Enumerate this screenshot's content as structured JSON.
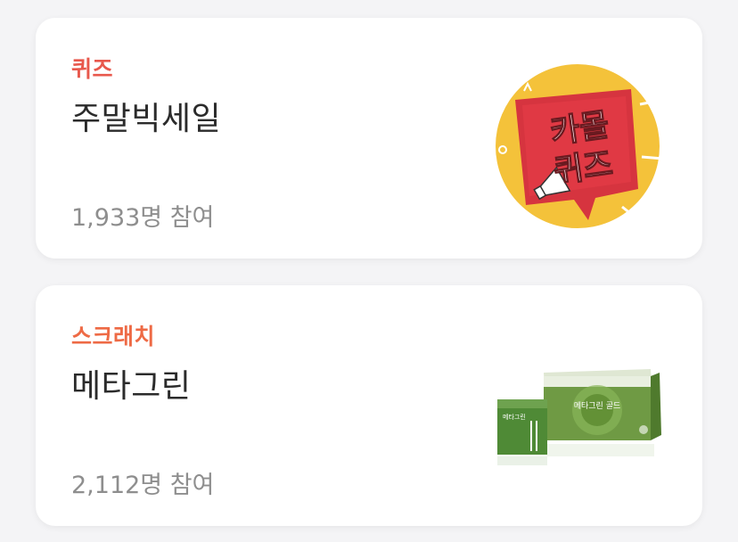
{
  "cards": [
    {
      "category": "퀴즈",
      "category_color": "#e8584c",
      "title": "주말빅세일",
      "count": "1,933명 참여",
      "image": {
        "icon": "quiz-badge-icon",
        "line1": "카몰",
        "line2": "퀴즈"
      }
    },
    {
      "category": "스크래치",
      "category_color": "#ee6a45",
      "title": "메타그린",
      "count": "2,112명 참여",
      "image": {
        "icon": "product-box-icon",
        "box_label": "메타그린 골드",
        "pouch_label": "메타그린"
      }
    }
  ]
}
